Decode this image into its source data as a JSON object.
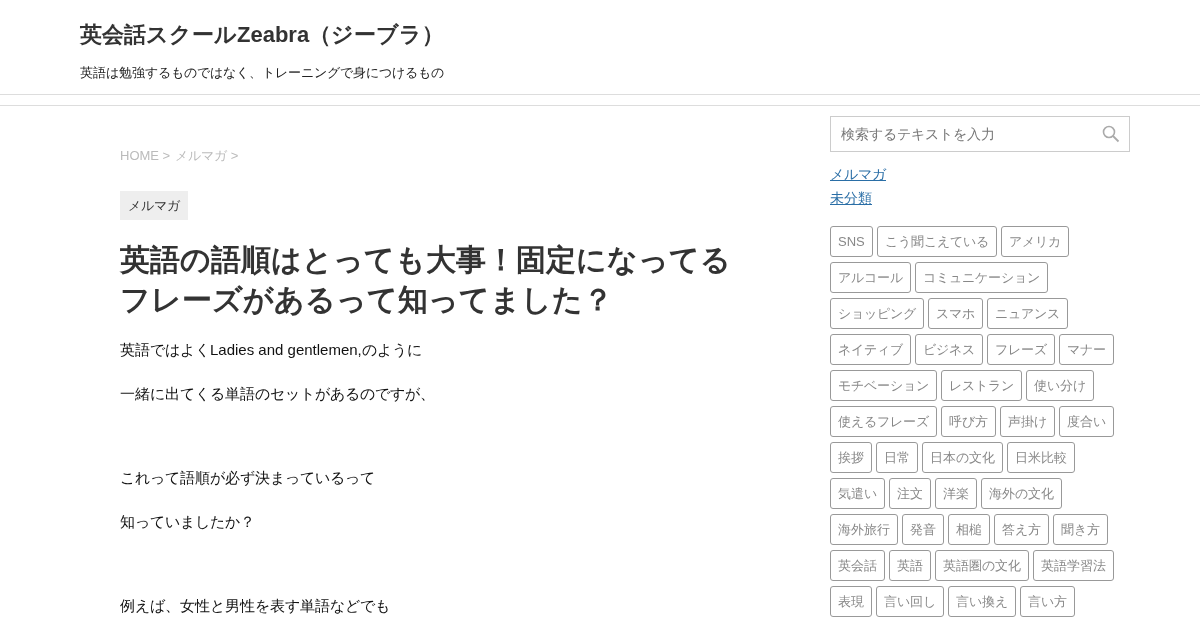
{
  "site": {
    "title": "英会話スクールZeabra（ジーブラ）",
    "tagline": "英語は勉強するものではなく、トレーニングで身につけるもの"
  },
  "breadcrumb": [
    "HOME >",
    "メルマガ >"
  ],
  "category_label": "メルマガ",
  "article": {
    "title": "英語の語順はとっても大事！固定になってるフレーズがあるって知ってました？",
    "paragraphs": [
      {
        "kind": "text",
        "text": "英語ではよくLadies and gentlemen,のように"
      },
      {
        "kind": "text",
        "text": "一緒に出てくる単語のセットがあるのですが、"
      },
      {
        "kind": "blank"
      },
      {
        "kind": "text",
        "text": "これって語順が必ず決まっているって"
      },
      {
        "kind": "text",
        "text": "知っていましたか？"
      },
      {
        "kind": "blank"
      },
      {
        "kind": "text",
        "text": "例えば、女性と男性を表す単語などでも"
      }
    ]
  },
  "sidebar": {
    "search": {
      "placeholder": "検索するテキストを入力"
    },
    "categories": [
      "メルマガ",
      "未分類"
    ],
    "tags": [
      "SNS",
      "こう聞こえている",
      "アメリカ",
      "アルコール",
      "コミュニケーション",
      "ショッピング",
      "スマホ",
      "ニュアンス",
      "ネイティブ",
      "ビジネス",
      "フレーズ",
      "マナー",
      "モチベーション",
      "レストラン",
      "使い分け",
      "使えるフレーズ",
      "呼び方",
      "声掛け",
      "度合い",
      "挨拶",
      "日常",
      "日本の文化",
      "日米比較",
      "気遣い",
      "注文",
      "洋楽",
      "海外の文化",
      "海外旅行",
      "発音",
      "相槌",
      "答え方",
      "聞き方",
      "英会話",
      "英語",
      "英語圏の文化",
      "英語学習法",
      "表現",
      "言い回し",
      "言い換え",
      "言い方"
    ]
  }
}
